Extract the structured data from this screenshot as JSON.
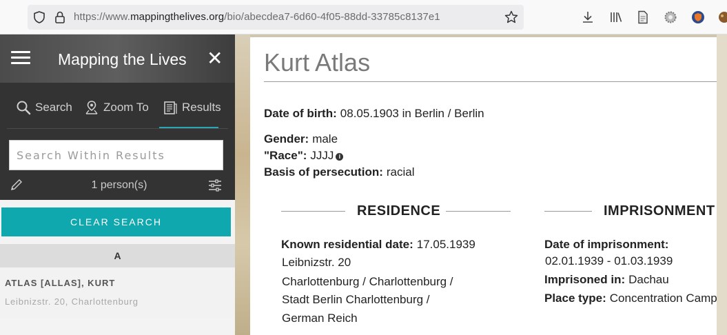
{
  "browser": {
    "url_prefix": "https://www.",
    "url_domain": "mappingthelives.org",
    "url_path": "/bio/abecdea7-6d60-4f05-88dd-33785c8137e1"
  },
  "sidebar": {
    "title": "Mapping the Lives",
    "tabs": [
      {
        "label": "Search",
        "icon": "search-icon"
      },
      {
        "label": "Zoom To",
        "icon": "map-pin-icon"
      },
      {
        "label": "Results",
        "icon": "results-icon"
      }
    ],
    "search_placeholder": "Search Within Results",
    "count": "1 person(s)",
    "clear_label": "CLEAR SEARCH",
    "letter": "A",
    "result": {
      "name": "ATLAS [ALLAS], KURT",
      "address": "Leibnizstr. 20, Charlottenburg"
    }
  },
  "person": {
    "name": "Kurt Atlas",
    "birth_label": "Date of birth:",
    "birth_value": "08.05.1903 in Berlin / Berlin",
    "gender_label": "Gender:",
    "gender_value": "male",
    "race_label": "\"Race\":",
    "race_value": "JJJJ",
    "basis_label": "Basis of persecution:",
    "basis_value": "racial"
  },
  "residence": {
    "title": "RESIDENCE",
    "date_label": "Known residential date:",
    "date_value": "17.05.1939",
    "lines": [
      "Leibnizstr. 20",
      "Charlottenburg / Charlottenburg /",
      "Stadt Berlin Charlottenburg /",
      "German Reich"
    ]
  },
  "imprisonment": {
    "title": "IMPRISONMENT",
    "date_label": "Date of imprisonment:",
    "date_value": "02.01.1939 - 01.03.1939",
    "place_label": "Imprisoned in:",
    "place_value": "Dachau",
    "type_label": "Place type:",
    "type_value": "Concentration Camp"
  },
  "colors": {
    "accent": "#0fa8af",
    "sidebar_dark": "#333333"
  }
}
